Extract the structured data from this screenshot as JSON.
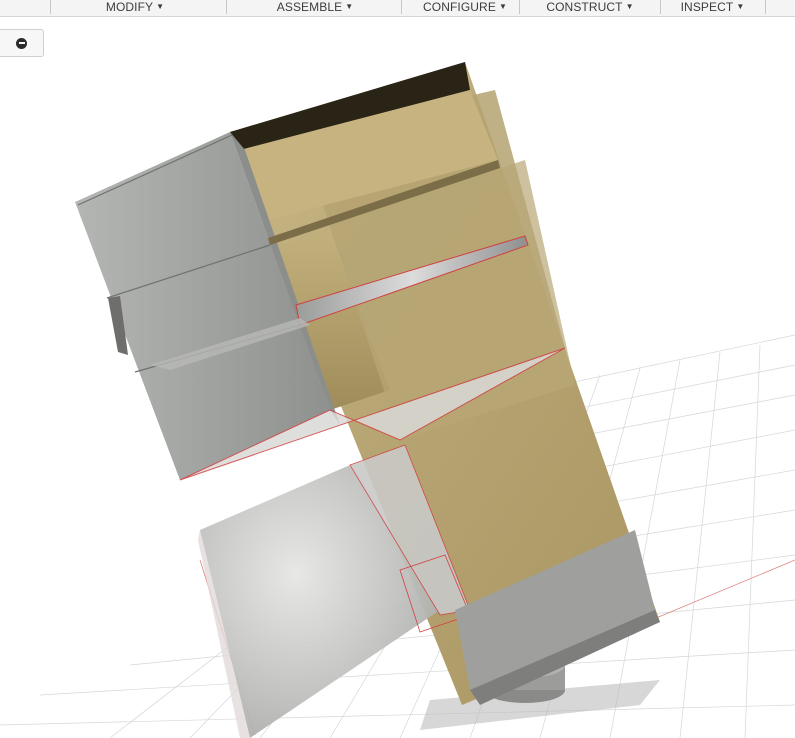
{
  "toolbar": {
    "menus": [
      {
        "label": "MODIFY"
      },
      {
        "label": "ASSEMBLE"
      },
      {
        "label": "CONFIGURE"
      },
      {
        "label": "CONSTRUCT"
      },
      {
        "label": "INSPECT"
      }
    ]
  },
  "icons": {
    "view_control": "minus-circle-icon",
    "menu_caret": "caret-down-icon"
  },
  "colors": {
    "wood": "#b9a777",
    "wood_dark": "#8f7e52",
    "grey_panel": "#a3a5a3",
    "grid": "#d0d3d6",
    "edge_red": "#d04040"
  }
}
